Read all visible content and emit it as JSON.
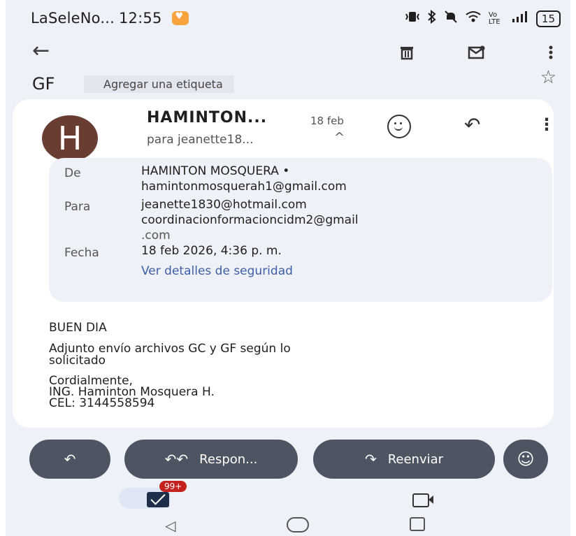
{
  "status_bar": {
    "carrier": "LaSeleNo...",
    "time": "12:55",
    "network": "Vo LTE",
    "battery": "15"
  },
  "toolbar": {
    "back_icon": "arrow-back-icon",
    "delete_icon": "trash-icon",
    "mark_unread_icon": "mail-unread-icon",
    "more_icon": "more-vert-icon"
  },
  "label_row": {
    "subject": "GF",
    "add_label": "Agregar una etiqueta",
    "star_icon": "star-outline-icon"
  },
  "message": {
    "avatar_initial": "H",
    "avatar_color": "#6a3d32",
    "sender": "HAMINTON...",
    "date": "18 feb",
    "to_line": "para jeanette18...",
    "chevron": "^",
    "details": {
      "from_label": "De",
      "from_name": "HAMINTON MOSQUERA •",
      "from_email": "hamintonmosquerah1@gmail.com",
      "to_label": "Para",
      "to_email1": "jeanette1830@hotmail.com",
      "to_email2_line1": "coordinacionformacioncidm2@gmail",
      "to_email2_line2": ".com",
      "date_label": "Fecha",
      "date_value": "18 feb 2026, 4:36 p. m.",
      "security_link": "Ver detalles de seguridad"
    },
    "body": {
      "greeting": "BUEN DIA",
      "line1": "Adjunto envío archivos GC y GF según lo",
      "line2": "solicitado",
      "closing": "Cordialmente,",
      "signature_name": "ING. Haminton Mosquera H.",
      "signature_phone": "CEL: 3144558594"
    }
  },
  "actions": {
    "reply_all_label": "Respon...",
    "forward_label": "Reenviar",
    "button_color": "#4d5462"
  },
  "bottom_nav": {
    "mail_badge": "99+",
    "mail_icon": "mail-icon",
    "meet_icon": "video-icon"
  }
}
